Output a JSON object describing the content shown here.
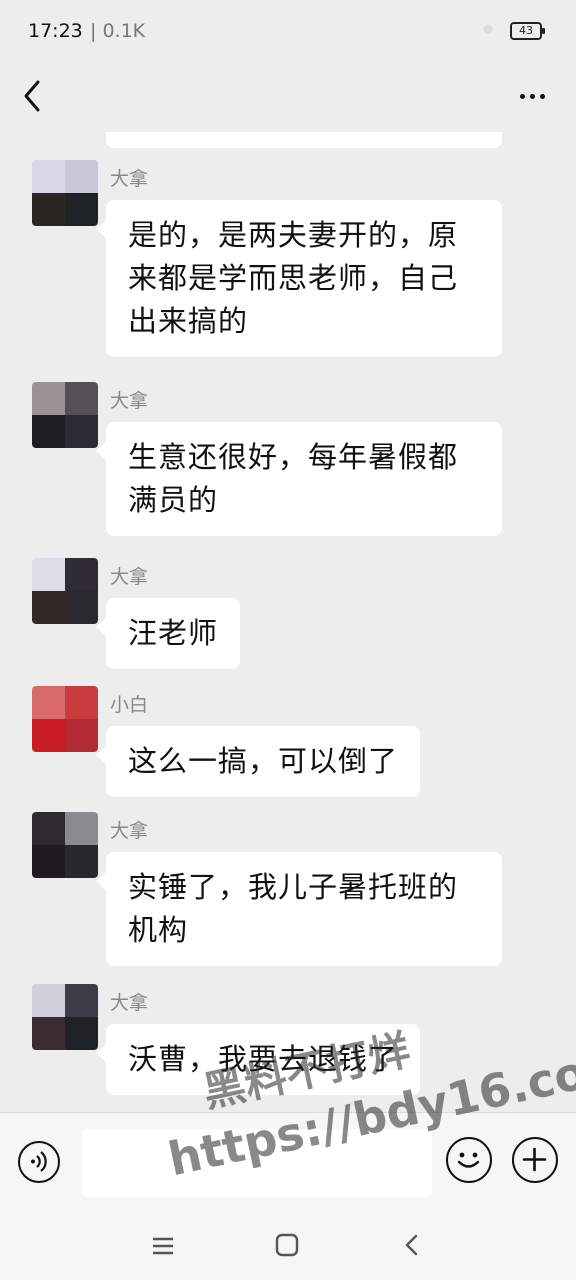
{
  "status_bar": {
    "time": "17:23",
    "network": "0.1K",
    "battery": "43"
  },
  "header": {
    "back_icon": "chevron-left-icon",
    "more_icon": "more-horizontal-icon"
  },
  "messages": [
    {
      "sender": "大拿",
      "text": "是的，是两夫妻开的，原来都是学而思老师，自己出来搞的"
    },
    {
      "sender": "大拿",
      "text": "生意还很好，每年暑假都满员的"
    },
    {
      "sender": "大拿",
      "text": "汪老师"
    },
    {
      "sender": "小白",
      "text": "这么一搞，可以倒了"
    },
    {
      "sender": "大拿",
      "text": "实锤了，我儿子暑托班的机构"
    },
    {
      "sender": "大拿",
      "text": "沃曹，我要去退钱了"
    }
  ],
  "avatars": [
    [
      "#d8d9e6",
      "#c9c8d6",
      "#2a2622",
      "#1e2327"
    ],
    [
      "#9b9396",
      "#574f56",
      "#1d1d22",
      "#2a2c33"
    ],
    [
      "#dadce8",
      "#302c35",
      "#332826",
      "#2a2a2e"
    ],
    [
      "#d96a6c",
      "#c73b3c",
      "#c81d27",
      "#b52b33"
    ],
    [
      "#2e2a30",
      "#8a8a90",
      "#1f1c20",
      "#26292e"
    ],
    [
      "#cfd0dc",
      "#3c3c48",
      "#3a2c30",
      "#1f2226"
    ]
  ],
  "input_bar": {
    "voice_icon": "voice-icon",
    "emoji_icon": "emoji-icon",
    "plus_icon": "plus-icon",
    "placeholder": ""
  },
  "system_nav": {
    "menu_icon": "menu-icon",
    "home_icon": "home-icon",
    "back_icon": "back-icon"
  },
  "watermark": {
    "line1": "黑料不打烊",
    "line2": "https://bdy16.co"
  }
}
